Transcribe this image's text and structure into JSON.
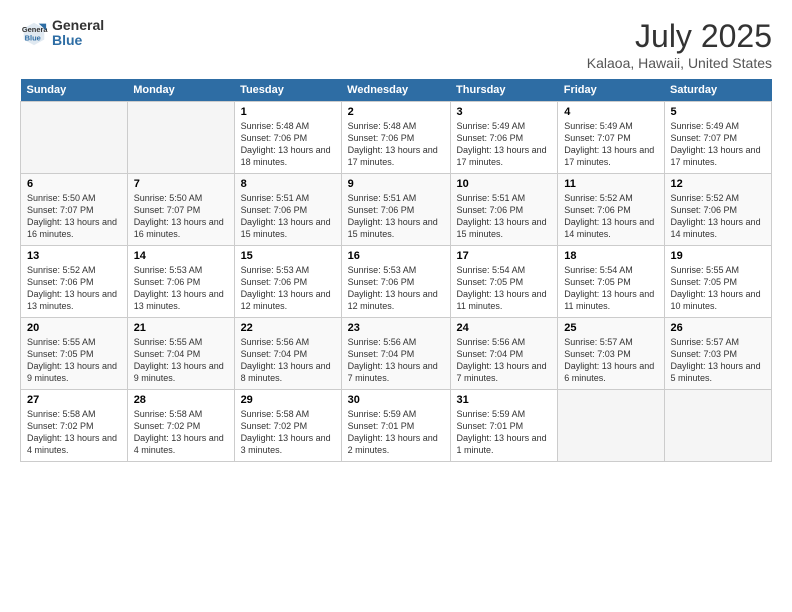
{
  "header": {
    "logo_general": "General",
    "logo_blue": "Blue",
    "title": "July 2025",
    "subtitle": "Kalaoa, Hawaii, United States"
  },
  "days_of_week": [
    "Sunday",
    "Monday",
    "Tuesday",
    "Wednesday",
    "Thursday",
    "Friday",
    "Saturday"
  ],
  "weeks": [
    [
      {
        "num": "",
        "sunrise": "",
        "sunset": "",
        "daylight": ""
      },
      {
        "num": "",
        "sunrise": "",
        "sunset": "",
        "daylight": ""
      },
      {
        "num": "1",
        "sunrise": "Sunrise: 5:48 AM",
        "sunset": "Sunset: 7:06 PM",
        "daylight": "Daylight: 13 hours and 18 minutes."
      },
      {
        "num": "2",
        "sunrise": "Sunrise: 5:48 AM",
        "sunset": "Sunset: 7:06 PM",
        "daylight": "Daylight: 13 hours and 17 minutes."
      },
      {
        "num": "3",
        "sunrise": "Sunrise: 5:49 AM",
        "sunset": "Sunset: 7:06 PM",
        "daylight": "Daylight: 13 hours and 17 minutes."
      },
      {
        "num": "4",
        "sunrise": "Sunrise: 5:49 AM",
        "sunset": "Sunset: 7:07 PM",
        "daylight": "Daylight: 13 hours and 17 minutes."
      },
      {
        "num": "5",
        "sunrise": "Sunrise: 5:49 AM",
        "sunset": "Sunset: 7:07 PM",
        "daylight": "Daylight: 13 hours and 17 minutes."
      }
    ],
    [
      {
        "num": "6",
        "sunrise": "Sunrise: 5:50 AM",
        "sunset": "Sunset: 7:07 PM",
        "daylight": "Daylight: 13 hours and 16 minutes."
      },
      {
        "num": "7",
        "sunrise": "Sunrise: 5:50 AM",
        "sunset": "Sunset: 7:07 PM",
        "daylight": "Daylight: 13 hours and 16 minutes."
      },
      {
        "num": "8",
        "sunrise": "Sunrise: 5:51 AM",
        "sunset": "Sunset: 7:06 PM",
        "daylight": "Daylight: 13 hours and 15 minutes."
      },
      {
        "num": "9",
        "sunrise": "Sunrise: 5:51 AM",
        "sunset": "Sunset: 7:06 PM",
        "daylight": "Daylight: 13 hours and 15 minutes."
      },
      {
        "num": "10",
        "sunrise": "Sunrise: 5:51 AM",
        "sunset": "Sunset: 7:06 PM",
        "daylight": "Daylight: 13 hours and 15 minutes."
      },
      {
        "num": "11",
        "sunrise": "Sunrise: 5:52 AM",
        "sunset": "Sunset: 7:06 PM",
        "daylight": "Daylight: 13 hours and 14 minutes."
      },
      {
        "num": "12",
        "sunrise": "Sunrise: 5:52 AM",
        "sunset": "Sunset: 7:06 PM",
        "daylight": "Daylight: 13 hours and 14 minutes."
      }
    ],
    [
      {
        "num": "13",
        "sunrise": "Sunrise: 5:52 AM",
        "sunset": "Sunset: 7:06 PM",
        "daylight": "Daylight: 13 hours and 13 minutes."
      },
      {
        "num": "14",
        "sunrise": "Sunrise: 5:53 AM",
        "sunset": "Sunset: 7:06 PM",
        "daylight": "Daylight: 13 hours and 13 minutes."
      },
      {
        "num": "15",
        "sunrise": "Sunrise: 5:53 AM",
        "sunset": "Sunset: 7:06 PM",
        "daylight": "Daylight: 13 hours and 12 minutes."
      },
      {
        "num": "16",
        "sunrise": "Sunrise: 5:53 AM",
        "sunset": "Sunset: 7:06 PM",
        "daylight": "Daylight: 13 hours and 12 minutes."
      },
      {
        "num": "17",
        "sunrise": "Sunrise: 5:54 AM",
        "sunset": "Sunset: 7:05 PM",
        "daylight": "Daylight: 13 hours and 11 minutes."
      },
      {
        "num": "18",
        "sunrise": "Sunrise: 5:54 AM",
        "sunset": "Sunset: 7:05 PM",
        "daylight": "Daylight: 13 hours and 11 minutes."
      },
      {
        "num": "19",
        "sunrise": "Sunrise: 5:55 AM",
        "sunset": "Sunset: 7:05 PM",
        "daylight": "Daylight: 13 hours and 10 minutes."
      }
    ],
    [
      {
        "num": "20",
        "sunrise": "Sunrise: 5:55 AM",
        "sunset": "Sunset: 7:05 PM",
        "daylight": "Daylight: 13 hours and 9 minutes."
      },
      {
        "num": "21",
        "sunrise": "Sunrise: 5:55 AM",
        "sunset": "Sunset: 7:04 PM",
        "daylight": "Daylight: 13 hours and 9 minutes."
      },
      {
        "num": "22",
        "sunrise": "Sunrise: 5:56 AM",
        "sunset": "Sunset: 7:04 PM",
        "daylight": "Daylight: 13 hours and 8 minutes."
      },
      {
        "num": "23",
        "sunrise": "Sunrise: 5:56 AM",
        "sunset": "Sunset: 7:04 PM",
        "daylight": "Daylight: 13 hours and 7 minutes."
      },
      {
        "num": "24",
        "sunrise": "Sunrise: 5:56 AM",
        "sunset": "Sunset: 7:04 PM",
        "daylight": "Daylight: 13 hours and 7 minutes."
      },
      {
        "num": "25",
        "sunrise": "Sunrise: 5:57 AM",
        "sunset": "Sunset: 7:03 PM",
        "daylight": "Daylight: 13 hours and 6 minutes."
      },
      {
        "num": "26",
        "sunrise": "Sunrise: 5:57 AM",
        "sunset": "Sunset: 7:03 PM",
        "daylight": "Daylight: 13 hours and 5 minutes."
      }
    ],
    [
      {
        "num": "27",
        "sunrise": "Sunrise: 5:58 AM",
        "sunset": "Sunset: 7:02 PM",
        "daylight": "Daylight: 13 hours and 4 minutes."
      },
      {
        "num": "28",
        "sunrise": "Sunrise: 5:58 AM",
        "sunset": "Sunset: 7:02 PM",
        "daylight": "Daylight: 13 hours and 4 minutes."
      },
      {
        "num": "29",
        "sunrise": "Sunrise: 5:58 AM",
        "sunset": "Sunset: 7:02 PM",
        "daylight": "Daylight: 13 hours and 3 minutes."
      },
      {
        "num": "30",
        "sunrise": "Sunrise: 5:59 AM",
        "sunset": "Sunset: 7:01 PM",
        "daylight": "Daylight: 13 hours and 2 minutes."
      },
      {
        "num": "31",
        "sunrise": "Sunrise: 5:59 AM",
        "sunset": "Sunset: 7:01 PM",
        "daylight": "Daylight: 13 hours and 1 minute."
      },
      {
        "num": "",
        "sunrise": "",
        "sunset": "",
        "daylight": ""
      },
      {
        "num": "",
        "sunrise": "",
        "sunset": "",
        "daylight": ""
      }
    ]
  ]
}
